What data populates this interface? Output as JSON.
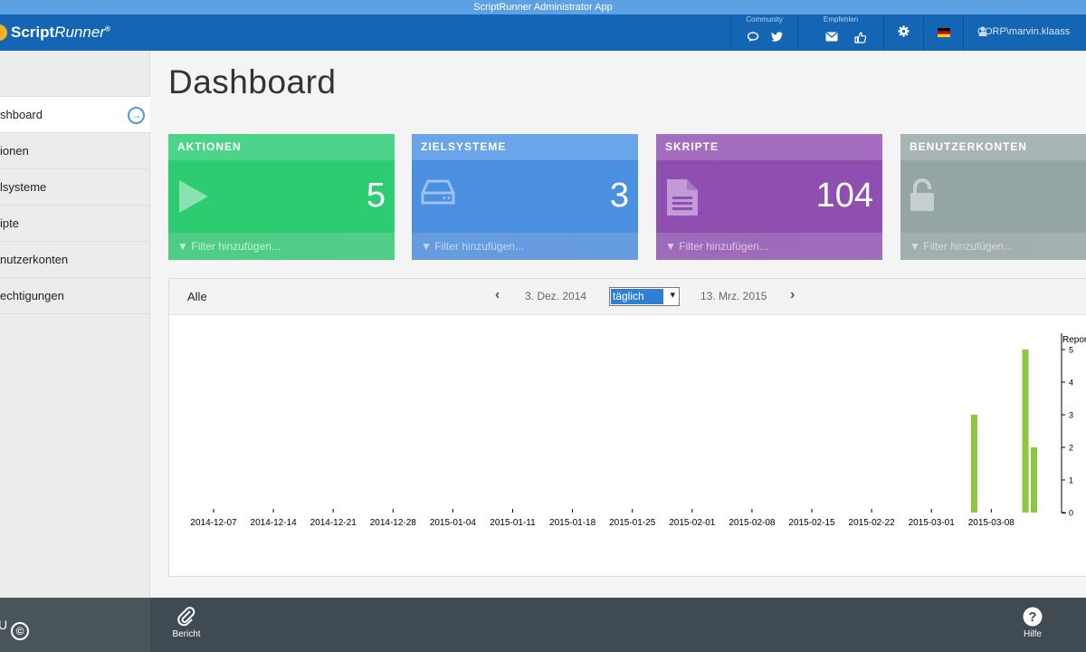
{
  "window": {
    "title": "ScriptRunner Administrator App"
  },
  "header": {
    "logo_text": "Script",
    "logo_text_italic": "Runner",
    "logo_reg": "®",
    "community_caption": "Community",
    "recommend_caption": "Empfehlen",
    "user": "CORP\\marvin.klaass"
  },
  "sidebar": {
    "items": [
      {
        "label": "shboard"
      },
      {
        "label": "ionen"
      },
      {
        "label": "lsysteme"
      },
      {
        "label": "ipte"
      },
      {
        "label": "nutzerkonten"
      },
      {
        "label": "echtigungen"
      }
    ]
  },
  "main": {
    "title": "Dashboard",
    "cards": [
      {
        "title": "AKTIONEN",
        "value": "5",
        "filter": "Filter hinzufügen..."
      },
      {
        "title": "ZIELSYSTEME",
        "value": "3",
        "filter": "Filter hinzufügen..."
      },
      {
        "title": "SKRIPTE",
        "value": "104",
        "filter": "Filter hinzufügen..."
      },
      {
        "title": "BENUTZERKONTEN",
        "value": "",
        "filter": "Filter hinzufügen..."
      }
    ]
  },
  "chart_toolbar": {
    "scope": "Alle",
    "start_date": "3. Dez. 2014",
    "interval": "täglich",
    "end_date": "13. Mrz. 2015"
  },
  "chart_data": {
    "type": "bar",
    "ylabel": "Repor",
    "ylim": [
      0,
      5
    ],
    "yticks": [
      "0",
      "1",
      "2",
      "3",
      "4",
      "5"
    ],
    "x_tick_labels": [
      "2014-12-07",
      "2014-12-14",
      "2014-12-21",
      "2014-12-28",
      "2015-01-04",
      "2015-01-11",
      "2015-01-18",
      "2015-01-25",
      "2015-02-01",
      "2015-02-08",
      "2015-02-15",
      "2015-02-22",
      "2015-03-01",
      "2015-03-08"
    ],
    "x": [
      "2015-03-06",
      "2015-03-12",
      "2015-03-13"
    ],
    "values": [
      3,
      5,
      2
    ],
    "bar_color": "#8dc63f"
  },
  "footer": {
    "report_label": "Bericht",
    "help_label": "Hilfe",
    "left_text": "U"
  },
  "colors": {
    "header_blue": "#1565b5",
    "green": "#2ecc71",
    "blue": "#4a8fe0",
    "purple": "#8e4fb0",
    "gray": "#95a5a5"
  }
}
